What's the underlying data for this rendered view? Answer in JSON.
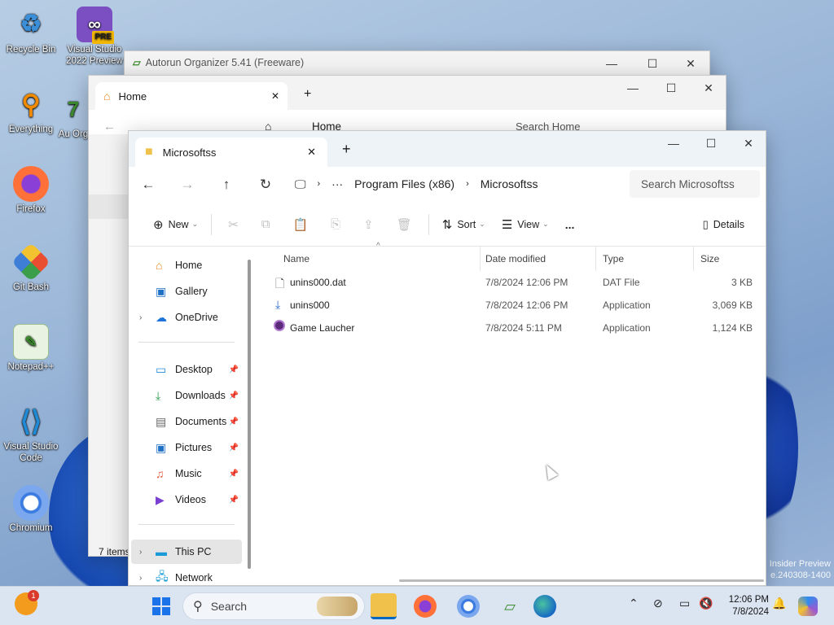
{
  "desktop": {
    "icons": [
      {
        "label": "Recycle Bin",
        "icon": "recycle-bin-icon"
      },
      {
        "label": "Visual Studio 2022 Preview",
        "icon": "visual-studio-icon",
        "badge": "PRE"
      },
      {
        "label": "Everything",
        "icon": "everything-search-icon"
      },
      {
        "label": "Au Org",
        "icon": "autorun-organizer-icon"
      },
      {
        "label": "Firefox",
        "icon": "firefox-icon"
      },
      {
        "label": "Git Bash",
        "icon": "git-bash-icon"
      },
      {
        "label": "Notepad++",
        "icon": "notepad-plus-plus-icon"
      },
      {
        "label": "Visual Studio Code",
        "icon": "vscode-icon"
      },
      {
        "label": "Chromium",
        "icon": "chromium-icon"
      }
    ],
    "watermark": [
      "Insider Preview",
      "e.240308-1400"
    ]
  },
  "back_window_autorun": {
    "title": "Autorun Organizer 5.41 (Freeware)"
  },
  "back_window_home": {
    "tab": "Home",
    "address": "Home",
    "search_placeholder": "Search Home",
    "status": "7 items"
  },
  "explorer": {
    "tab_title": "Microsoftss",
    "new_tab": "+",
    "breadcrumb": [
      "Program Files (x86)",
      "Microsoftss"
    ],
    "search_placeholder": "Search Microsoftss",
    "commands": {
      "new": "New",
      "sort": "Sort",
      "view": "View",
      "more": "...",
      "details": "Details"
    },
    "nav": {
      "home": "Home",
      "gallery": "Gallery",
      "onedrive": "OneDrive",
      "desktop": "Desktop",
      "downloads": "Downloads",
      "documents": "Documents",
      "pictures": "Pictures",
      "music": "Music",
      "videos": "Videos",
      "thispc": "This PC",
      "network": "Network"
    },
    "columns": {
      "name": "Name",
      "date": "Date modified",
      "type": "Type",
      "size": "Size"
    },
    "files": [
      {
        "name": "unins000.dat",
        "date": "7/8/2024 12:06 PM",
        "type": "DAT File",
        "size": "3 KB",
        "icon": "file-icon"
      },
      {
        "name": "unins000",
        "date": "7/8/2024 12:06 PM",
        "type": "Application",
        "size": "3,069 KB",
        "icon": "installer-icon"
      },
      {
        "name": "Game Laucher",
        "date": "7/8/2024 5:11 PM",
        "type": "Application",
        "size": "1,124 KB",
        "icon": "game-launcher-icon"
      }
    ]
  },
  "taskbar": {
    "search_placeholder": "Search",
    "notification_count": "1",
    "time": "12:06 PM",
    "date": "7/8/2024"
  },
  "colors": {
    "accent": "#0067c0",
    "folder": "#f0c24b",
    "taskbar": "#dbe5f2"
  }
}
